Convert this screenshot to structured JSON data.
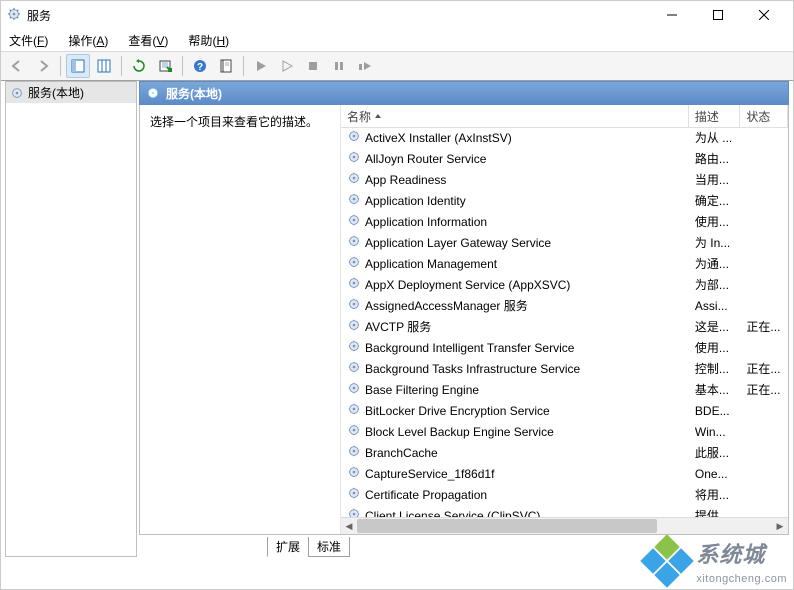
{
  "window": {
    "title": "服务"
  },
  "menu": {
    "file": {
      "label": "文件",
      "key": "F"
    },
    "action": {
      "label": "操作",
      "key": "A"
    },
    "view": {
      "label": "查看",
      "key": "V"
    },
    "help": {
      "label": "帮助",
      "key": "H"
    }
  },
  "toolbar": {
    "back": "后退",
    "forward": "前进",
    "show_hide_tree": "显示/隐藏控制台树",
    "sel_columns": "选择列",
    "refresh": "刷新",
    "export": "导出列表",
    "help": "帮助",
    "properties": "属性",
    "start": "启动",
    "resume": "恢复",
    "stop": "停止",
    "pause": "暂停",
    "restart": "重新启动"
  },
  "tree": {
    "root": "服务(本地)"
  },
  "header": {
    "category": "服务(本地)"
  },
  "detail": {
    "prompt": "选择一个项目来查看它的描述。"
  },
  "columns": {
    "name": "名称",
    "desc": "描述",
    "status": "状态"
  },
  "services": [
    {
      "name": "ActiveX Installer (AxInstSV)",
      "desc": "为从 ...",
      "status": ""
    },
    {
      "name": "AllJoyn Router Service",
      "desc": "路由...",
      "status": ""
    },
    {
      "name": "App Readiness",
      "desc": "当用...",
      "status": ""
    },
    {
      "name": "Application Identity",
      "desc": "确定...",
      "status": ""
    },
    {
      "name": "Application Information",
      "desc": "使用...",
      "status": ""
    },
    {
      "name": "Application Layer Gateway Service",
      "desc": "为 In...",
      "status": ""
    },
    {
      "name": "Application Management",
      "desc": "为通...",
      "status": ""
    },
    {
      "name": "AppX Deployment Service (AppXSVC)",
      "desc": "为部...",
      "status": ""
    },
    {
      "name": "AssignedAccessManager 服务",
      "desc": "Assi...",
      "status": ""
    },
    {
      "name": "AVCTP 服务",
      "desc": "这是...",
      "status": "正在..."
    },
    {
      "name": "Background Intelligent Transfer Service",
      "desc": "使用...",
      "status": ""
    },
    {
      "name": "Background Tasks Infrastructure Service",
      "desc": "控制...",
      "status": "正在..."
    },
    {
      "name": "Base Filtering Engine",
      "desc": "基本...",
      "status": "正在..."
    },
    {
      "name": "BitLocker Drive Encryption Service",
      "desc": "BDE...",
      "status": ""
    },
    {
      "name": "Block Level Backup Engine Service",
      "desc": "Win...",
      "status": ""
    },
    {
      "name": "BranchCache",
      "desc": "此服...",
      "status": ""
    },
    {
      "name": "CaptureService_1f86d1f",
      "desc": "One...",
      "status": ""
    },
    {
      "name": "Certificate Propagation",
      "desc": "将用...",
      "status": ""
    },
    {
      "name": "Client License Service (ClipSVC)",
      "desc": "提供...",
      "status": ""
    }
  ],
  "tabs": {
    "extended": "扩展",
    "standard": "标准"
  },
  "watermark": {
    "line1": "系统城",
    "line2": "xitongcheng.com"
  }
}
